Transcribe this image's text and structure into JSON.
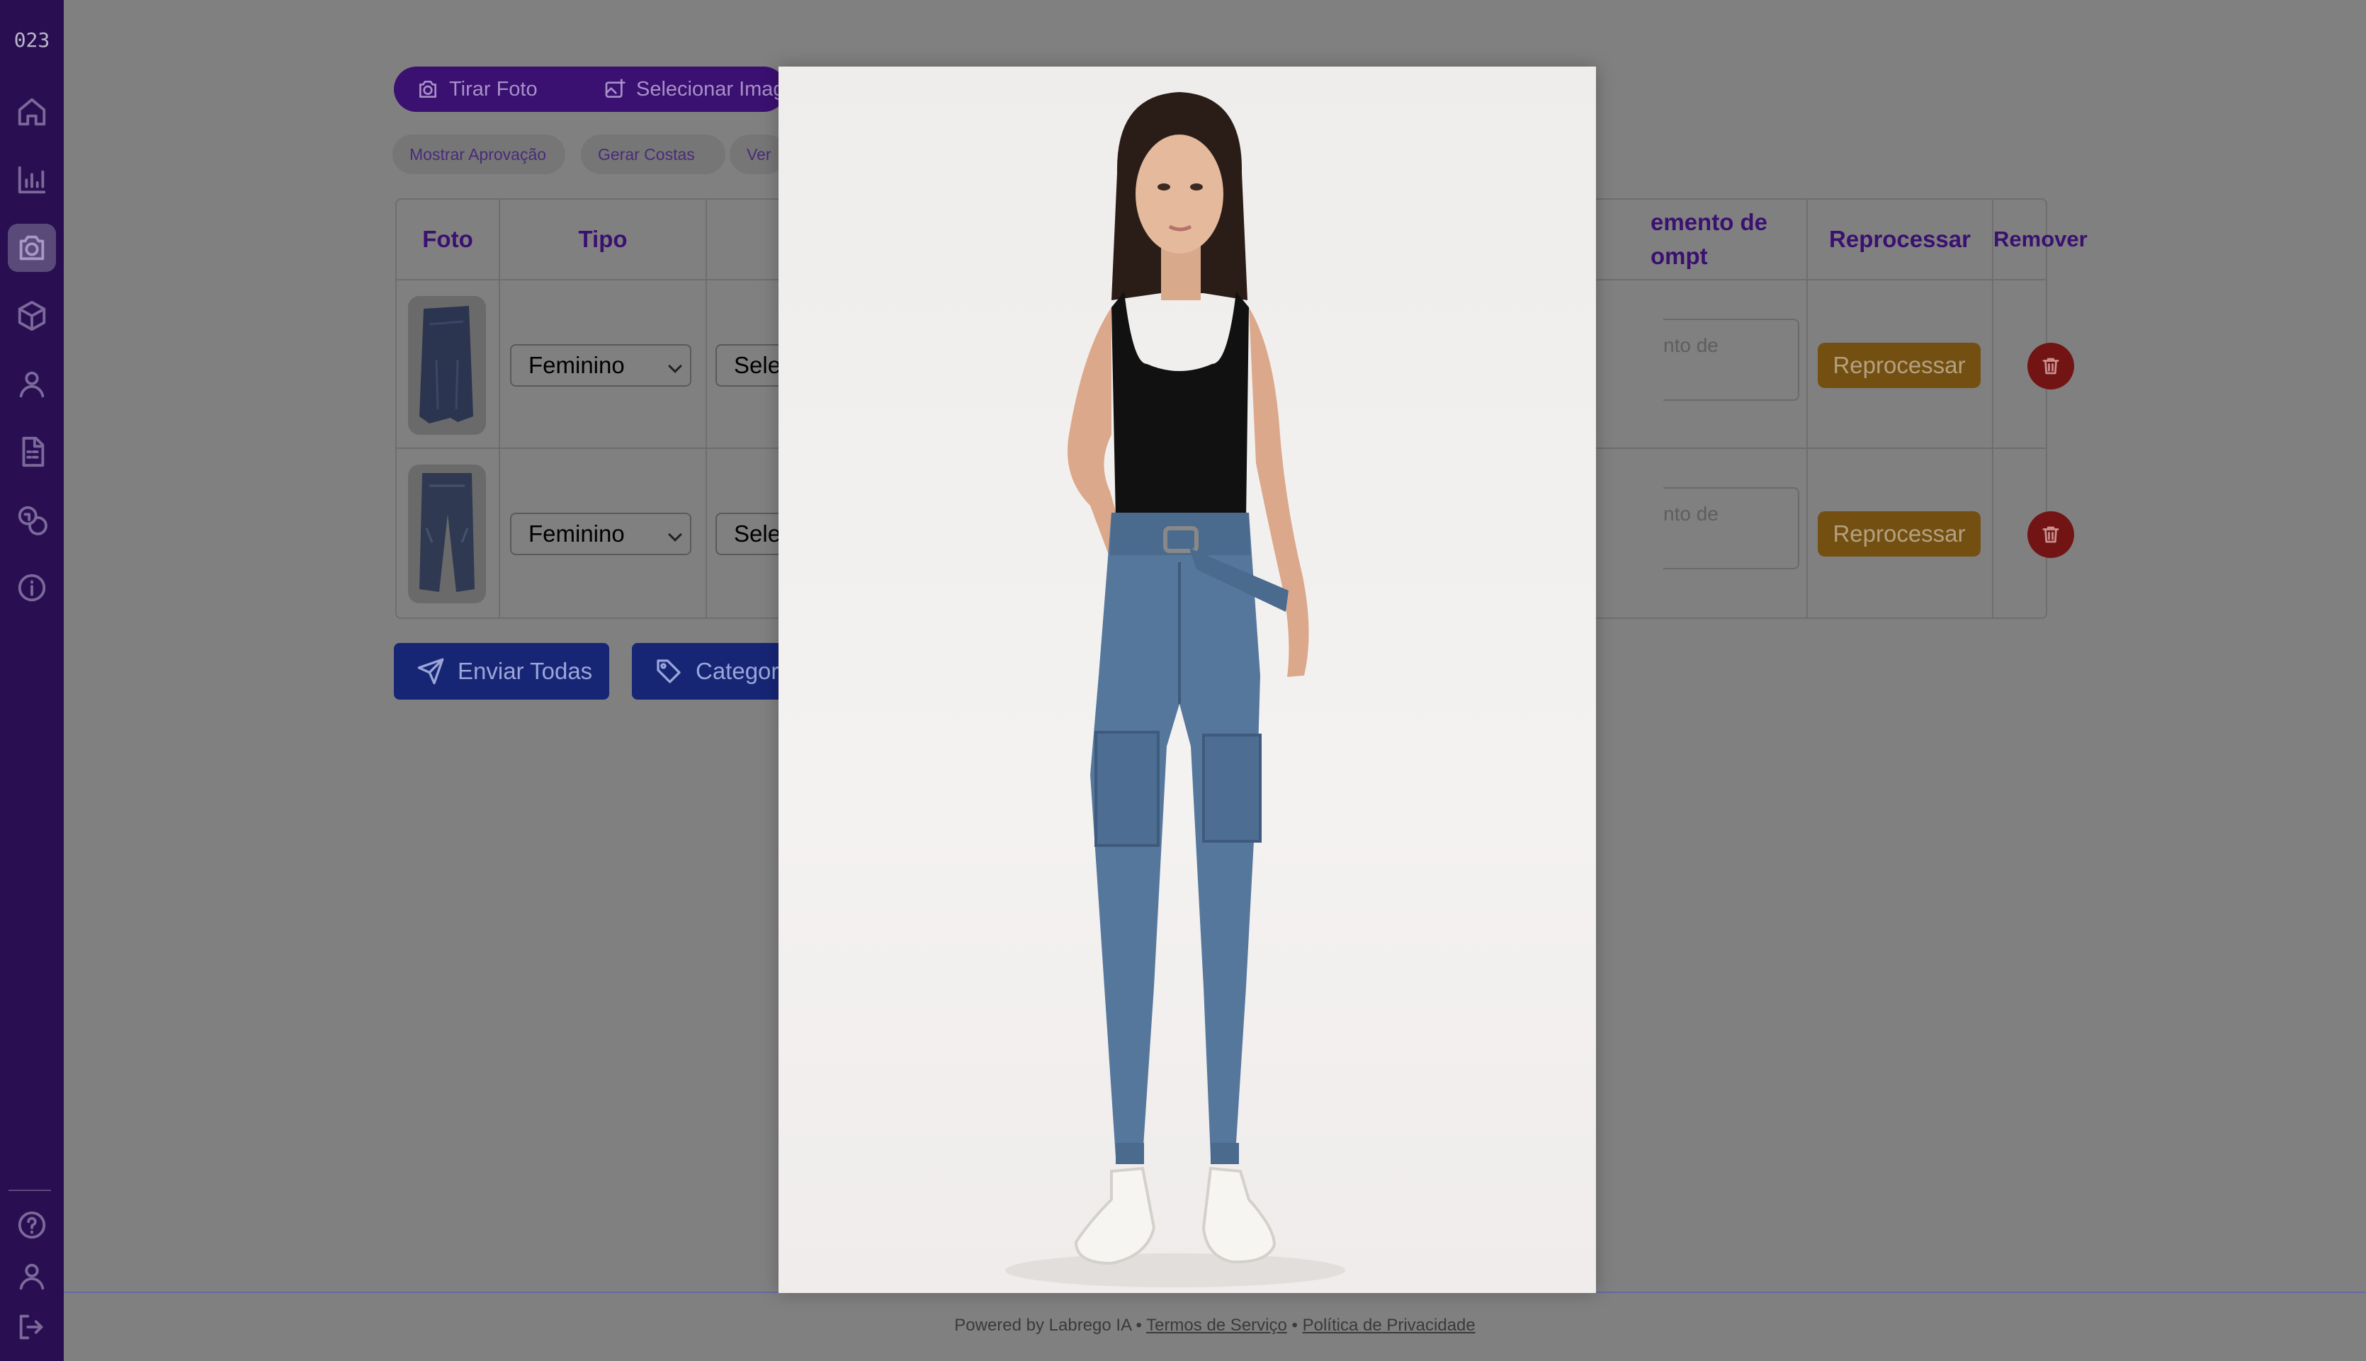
{
  "sidebar": {
    "logo": "023",
    "items": [
      {
        "name": "home-icon",
        "active": false
      },
      {
        "name": "chart-icon",
        "active": false
      },
      {
        "name": "camera-icon",
        "active": true
      },
      {
        "name": "box-icon",
        "active": false
      },
      {
        "name": "user-icon",
        "active": false
      },
      {
        "name": "spreadsheet-icon",
        "active": false
      },
      {
        "name": "coins-icon",
        "active": false
      },
      {
        "name": "info-icon",
        "active": false
      }
    ],
    "bottom": [
      "help-icon",
      "profile-icon",
      "logout-icon"
    ]
  },
  "toolbar": {
    "take_photo": "Tirar Foto",
    "select_images": "Selecionar Imag",
    "chips": [
      "Mostrar Aprovação",
      "Gerar Costas",
      "Ver"
    ]
  },
  "table": {
    "headers": {
      "photo": "Foto",
      "type": "Tipo",
      "complement_line1": "emento de",
      "complement_line2": "ompt",
      "reprocess": "Reprocessar",
      "remove": "Remover"
    },
    "rows": [
      {
        "type": "Feminino",
        "category": "Sele",
        "complement_placeholder": "nto de",
        "reprocess_label": "Reprocessar"
      },
      {
        "type": "Feminino",
        "category": "Sele",
        "complement_placeholder": "nto de",
        "reprocess_label": "Reprocessar"
      }
    ]
  },
  "actions": {
    "send_all": "Enviar Todas",
    "categorize": "Categori"
  },
  "footer": {
    "powered": "Powered by Labrego IA",
    "sep": "•",
    "terms": "Termos de Serviço",
    "privacy": "Política de Privacidade"
  },
  "colors": {
    "sidebar": "#2a0e52",
    "accent_purple": "#3a1070",
    "reprocess": "#735012",
    "delete": "#731414",
    "send_blue": "#172575",
    "overlay": "#808080"
  }
}
